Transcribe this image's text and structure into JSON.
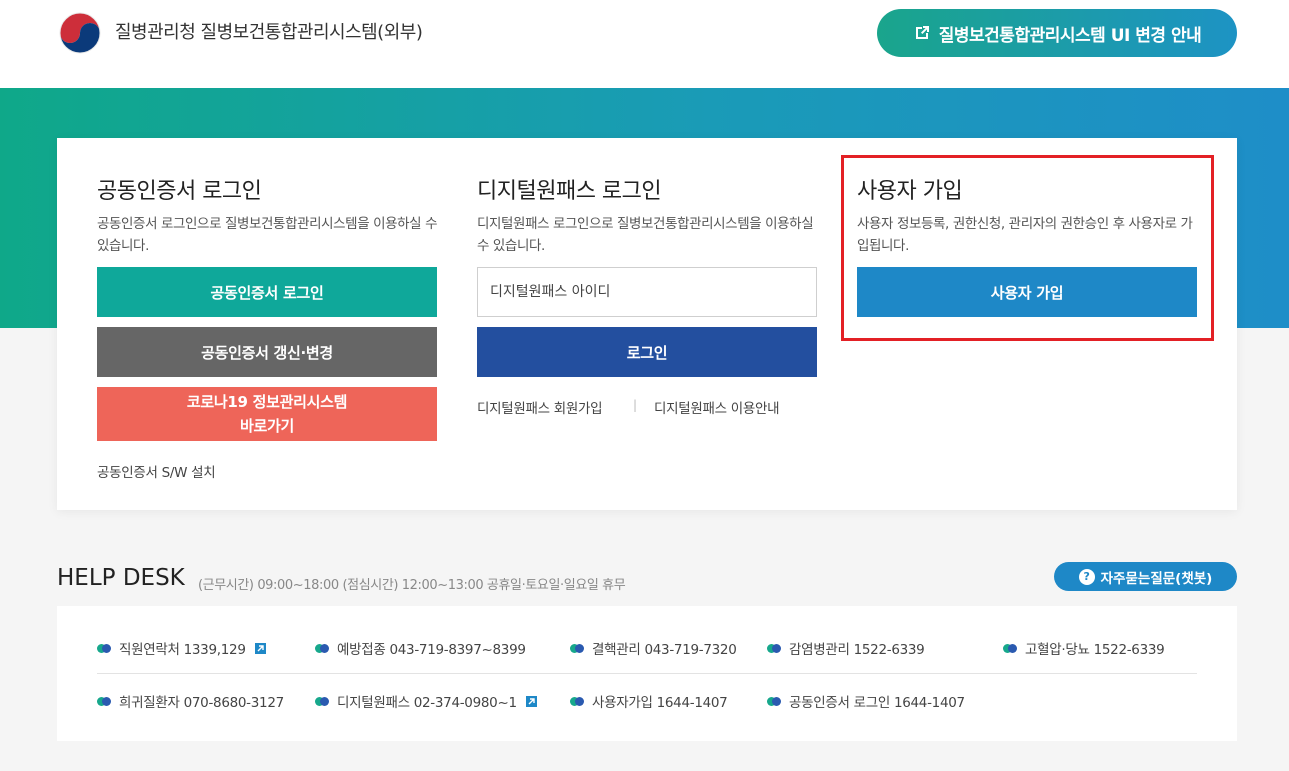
{
  "header": {
    "title": "질병관리청 질병보건통합관리시스템(외부)",
    "ui_notice_label": "질병보건통합관리시스템 UI 변경 안내"
  },
  "cert_login": {
    "title": "공동인증서 로그인",
    "desc": "공동인증서 로그인으로 질병보건통합관리시스템을 이용하실 수 있습니다.",
    "login_label": "공동인증서 로그인",
    "renew_label": "공동인증서 갱신·변경",
    "covid_line1": "코로나19 정보관리시스템",
    "covid_line2": "바로가기",
    "sw_install_label": "공동인증서 S/W 설치"
  },
  "digital_login": {
    "title": "디지털원패스 로그인",
    "desc": "디지털원패스 로그인으로 질병보건통합관리시스템을 이용하실수 있습니다.",
    "id_placeholder": "디지털원패스 아이디",
    "login_label": "로그인",
    "join_label": "디지털원패스 회원가입",
    "separator": "|",
    "guide_label": "디지털원패스 이용안내"
  },
  "signup": {
    "title": "사용자 가입",
    "desc": "사용자 정보등록, 권한신청, 관리자의 권한승인 후 사용자로 가입됩니다.",
    "button_label": "사용자 가입"
  },
  "helpdesk": {
    "title": "HELP DESK",
    "hours": "(근무시간) 09:00~18:00 (점심시간) 12:00~13:00 공휴일·토요일·일요일 휴무",
    "faq_label": "자주묻는질문(챗봇)",
    "faq_icon": "?",
    "row1": [
      {
        "text": "직원연락처 1339,129",
        "external": true
      },
      {
        "text": "예방접종 043-719-8397~8399",
        "external": false
      },
      {
        "text": "결핵관리 043-719-7320",
        "external": false
      },
      {
        "text": "감염병관리 1522-6339",
        "external": false
      },
      {
        "text": "고혈압·당뇨 1522-6339",
        "external": false
      }
    ],
    "row2": [
      {
        "text": "희귀질환자 070-8680-3127",
        "external": false
      },
      {
        "text": "디지털원패스 02-374-0980~1",
        "external": true
      },
      {
        "text": "사용자가입 1644-1407",
        "external": false
      },
      {
        "text": "공동인증서 로그인 1644-1407",
        "external": false
      }
    ]
  },
  "colors": {
    "hero_start": "#0fa889",
    "hero_end": "#1e8ec8",
    "teal_button": "#0fa89a",
    "gray_button": "#666666",
    "coral_button": "#ee6559",
    "navy_button": "#234f9f",
    "blue_button": "#1e88c7",
    "highlight_border": "#e32025"
  }
}
